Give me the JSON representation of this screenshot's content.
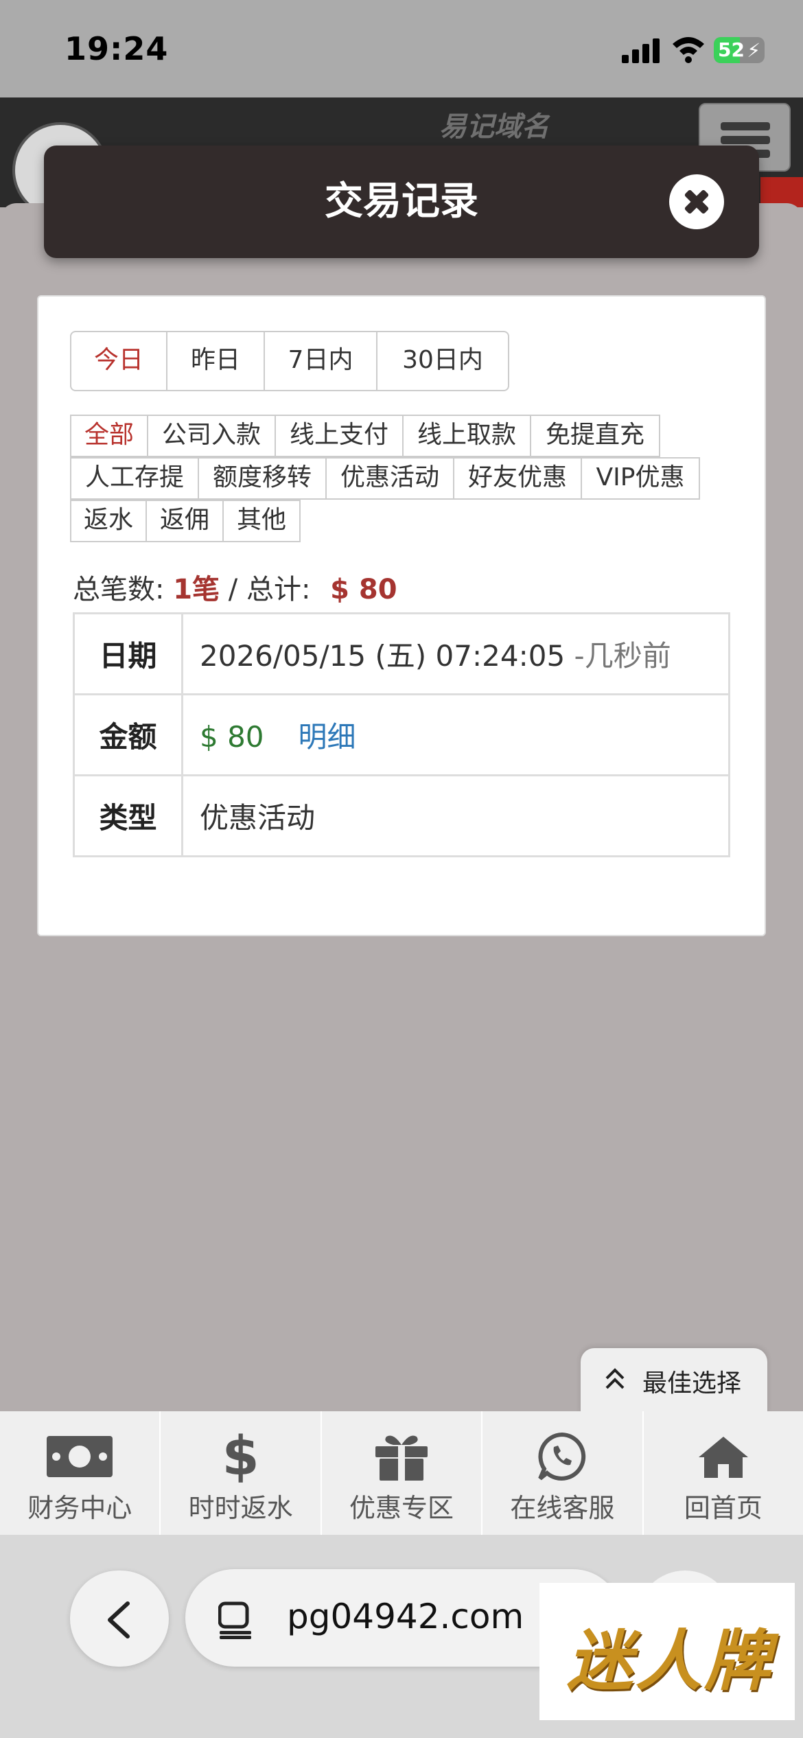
{
  "status": {
    "time": "19:24",
    "battery": "52",
    "battery_level": 0.52
  },
  "site": {
    "domain_label": "易记域名"
  },
  "modal": {
    "title": "交易记录"
  },
  "periods": [
    {
      "label": "今日",
      "active": true
    },
    {
      "label": "昨日",
      "active": false
    },
    {
      "label": "7日内",
      "active": false
    },
    {
      "label": "30日内",
      "active": false
    }
  ],
  "types": [
    [
      {
        "label": "全部",
        "active": true
      },
      {
        "label": "公司入款"
      },
      {
        "label": "线上支付"
      },
      {
        "label": "线上取款"
      },
      {
        "label": "免提直充"
      }
    ],
    [
      {
        "label": "人工存提"
      },
      {
        "label": "额度移转"
      },
      {
        "label": "优惠活动"
      },
      {
        "label": "好友优惠"
      },
      {
        "label": "VIP优惠"
      }
    ],
    [
      {
        "label": "返水"
      },
      {
        "label": "返佣"
      },
      {
        "label": "其他"
      }
    ]
  ],
  "summary": {
    "count_label": "总笔数:",
    "count_value": "1笔",
    "separator": " / ",
    "total_label": "总计:",
    "total_value": "$ 80"
  },
  "record": {
    "date_key": "日期",
    "date_value": "2026/05/15 (五) 07:24:05",
    "date_ago": " -几秒前",
    "amount_key": "金额",
    "amount_value": "$ 80",
    "detail_link": "明细",
    "type_key": "类型",
    "type_value": "优惠活动"
  },
  "best_choice": {
    "label": "最佳选择"
  },
  "bottom_nav": [
    {
      "label": "财务中心",
      "icon": "money-icon"
    },
    {
      "label": "时时返水",
      "icon": "dollar-icon"
    },
    {
      "label": "优惠专区",
      "icon": "gift-icon"
    },
    {
      "label": "在线客服",
      "icon": "whatsapp-icon"
    },
    {
      "label": "回首页",
      "icon": "home-icon"
    }
  ],
  "browser": {
    "url": "pg04942.com"
  },
  "watermark": {
    "text": "迷人牌"
  },
  "colors": {
    "accent_red": "#b8322d",
    "amount_green": "#2e7a32",
    "link_blue": "#2d78b8",
    "modal_header": "#332b2b"
  }
}
